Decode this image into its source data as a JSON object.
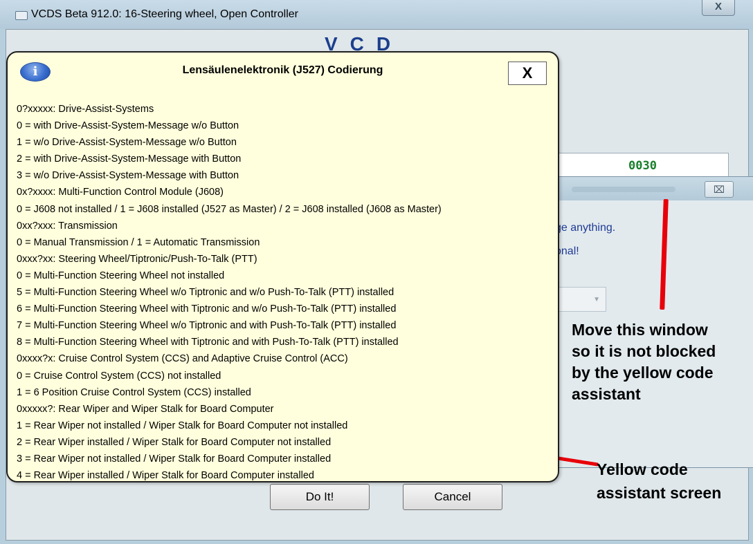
{
  "window": {
    "title": "VCDS Beta 912.0: 16-Steering wheel,  Open Controller",
    "close_glyph": "X",
    "logo_fragment": "VCD"
  },
  "coding_field": {
    "value": "0030"
  },
  "buttons": {
    "do_it": "Do It!",
    "cancel": "Cancel"
  },
  "secondary_dialog": {
    "close_glyph": "⌧",
    "line1": "ge anything.",
    "line2": "onal!"
  },
  "code_assistant": {
    "title": "Lensäulenelektronik (J527) Codierung",
    "close_glyph": "X",
    "info_icon_glyph": "i",
    "lines": [
      "0?xxxxx: Drive-Assist-Systems",
      "0 = with Drive-Assist-System-Message w/o Button",
      "1 = w/o Drive-Assist-System-Message w/o Button",
      "2 = with Drive-Assist-System-Message with Button",
      "3 = w/o Drive-Assist-System-Message with Button",
      "0x?xxxx: Multi-Function Control Module (J608)",
      "0 = J608 not installed / 1 = J608 installed (J527 as Master) / 2 = J608 installed (J608 as Master)",
      "0xx?xxx: Transmission",
      "0 = Manual Transmission / 1 = Automatic Transmission",
      "0xxx?xx: Steering Wheel/Tiptronic/Push-To-Talk (PTT)",
      "0 = Multi-Function Steering Wheel not installed",
      "5 = Multi-Function Steering Wheel w/o Tiptronic and w/o Push-To-Talk (PTT) installed",
      "6 = Multi-Function Steering Wheel with Tiptronic and w/o Push-To-Talk (PTT) installed",
      "7 = Multi-Function Steering Wheel w/o Tiptronic and with Push-To-Talk (PTT) installed",
      "8 = Multi-Function Steering Wheel with Tiptronic and with Push-To-Talk (PTT) installed",
      "0xxxx?x: Cruise Control System (CCS) and Adaptive Cruise Control (ACC)",
      "0 = Cruise Control System (CCS) not installed",
      "1 = 6 Position Cruise Control System (CCS) installed",
      "0xxxxx?: Rear Wiper and Wiper Stalk for Board Computer",
      "1 = Rear Wiper not installed / Wiper Stalk for Board Computer not installed",
      "2 = Rear Wiper installed / Wiper Stalk for Board Computer not installed",
      "3 = Rear Wiper not installed / Wiper Stalk for Board Computer installed",
      "4 = Rear Wiper installed / Wiper Stalk for Board Computer installed"
    ]
  },
  "annotations": {
    "move_window": [
      "Move this window",
      "so it is not blocked",
      "by the yellow code",
      "assistant"
    ],
    "yellow_screen": [
      "Yellow code",
      "assistant screen"
    ]
  },
  "colors": {
    "popup_background": "#ffffdd",
    "coding_value": "#17802a",
    "annotation_arrow": "#e8000a",
    "dialog_text": "#1f3a93"
  }
}
